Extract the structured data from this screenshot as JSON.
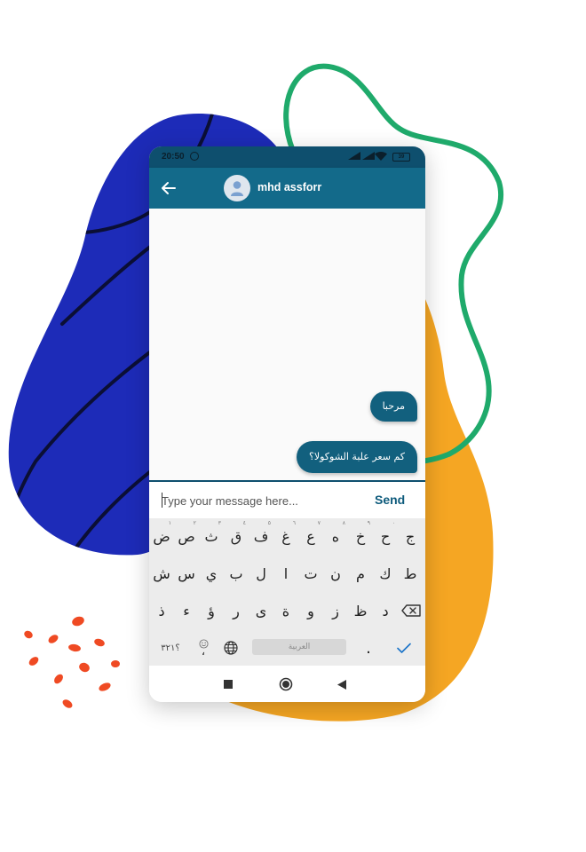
{
  "statusbar": {
    "time": "20:50",
    "battery": "39"
  },
  "header": {
    "contact_name": "mhd assforr"
  },
  "messages": [
    {
      "text": "مرحبا"
    },
    {
      "text": "كم سعر علبة الشوكولا؟"
    }
  ],
  "composer": {
    "placeholder": "Type your message here...",
    "send_label": "Send"
  },
  "keyboard": {
    "row1": [
      "ض",
      "ص",
      "ث",
      "ق",
      "ف",
      "غ",
      "ع",
      "ه",
      "خ",
      "ح",
      "ج"
    ],
    "row1_hints": [
      "١",
      "٢",
      "٣",
      "٤",
      "٥",
      "٦",
      "٧",
      "٨",
      "٩",
      "٠",
      ""
    ],
    "row2": [
      "ش",
      "س",
      "ي",
      "ب",
      "ل",
      "ا",
      "ت",
      "ن",
      "م",
      "ك",
      "ط"
    ],
    "row3": [
      "ذ",
      "ء",
      "ؤ",
      "ر",
      "ى",
      "ة",
      "و",
      "ز",
      "ظ",
      "د"
    ],
    "numbers_key": "؟٣٢١",
    "comma_key": "،",
    "period_key": ".",
    "language_label": "العربية"
  },
  "colors": {
    "app_bar": "#136a8a",
    "status_bar": "#0e4f6e",
    "bubble": "#12607e",
    "accent": "#0e5b7c",
    "blob_blue": "#1d2bb8",
    "blob_orange": "#f5a623",
    "green_line": "#1faa6b",
    "red_dots": "#ef4a23"
  },
  "icons": {
    "back": "arrow-left-icon",
    "avatar": "person-icon",
    "backspace": "backspace-icon",
    "enter": "checkmark-icon",
    "language": "globe-icon",
    "emoji": "smiley-icon",
    "nav_recent": "square-icon",
    "nav_home": "circle-icon",
    "nav_back": "triangle-back-icon"
  }
}
